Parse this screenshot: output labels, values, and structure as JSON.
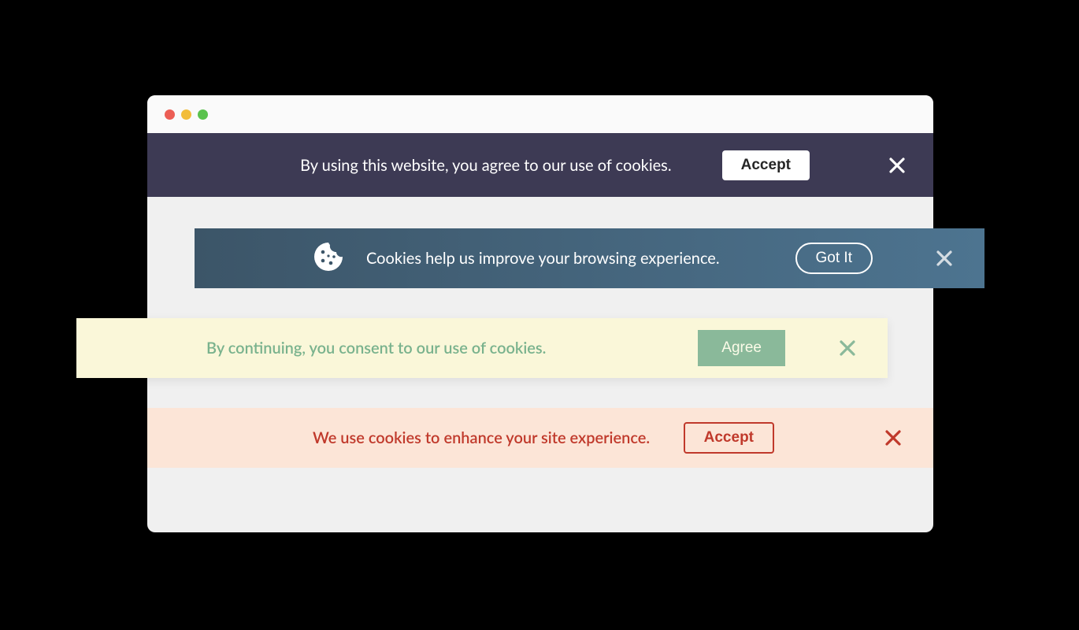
{
  "banners": [
    {
      "message": "By using this website, you agree to our use of cookies.",
      "button": "Accept",
      "bg": "#3d3a54",
      "text_color": "#ffffff",
      "button_style": "solid-white"
    },
    {
      "message": "Cookies help us improve your browsing experience.",
      "button": "Got It",
      "bg": "#3c5568",
      "text_color": "#ffffff",
      "button_style": "outline-white-pill",
      "icon": "cookie-icon"
    },
    {
      "message": "By continuing, you consent to our use of cookies.",
      "button": "Agree",
      "bg": "#faf7d9",
      "text_color": "#79b28d",
      "button_style": "solid-green"
    },
    {
      "message": "We use cookies to enhance your site experience.",
      "button": "Accept",
      "bg": "#fce5d7",
      "text_color": "#c0392b",
      "button_style": "outline-red"
    }
  ],
  "window_controls": [
    "close",
    "minimize",
    "maximize"
  ]
}
